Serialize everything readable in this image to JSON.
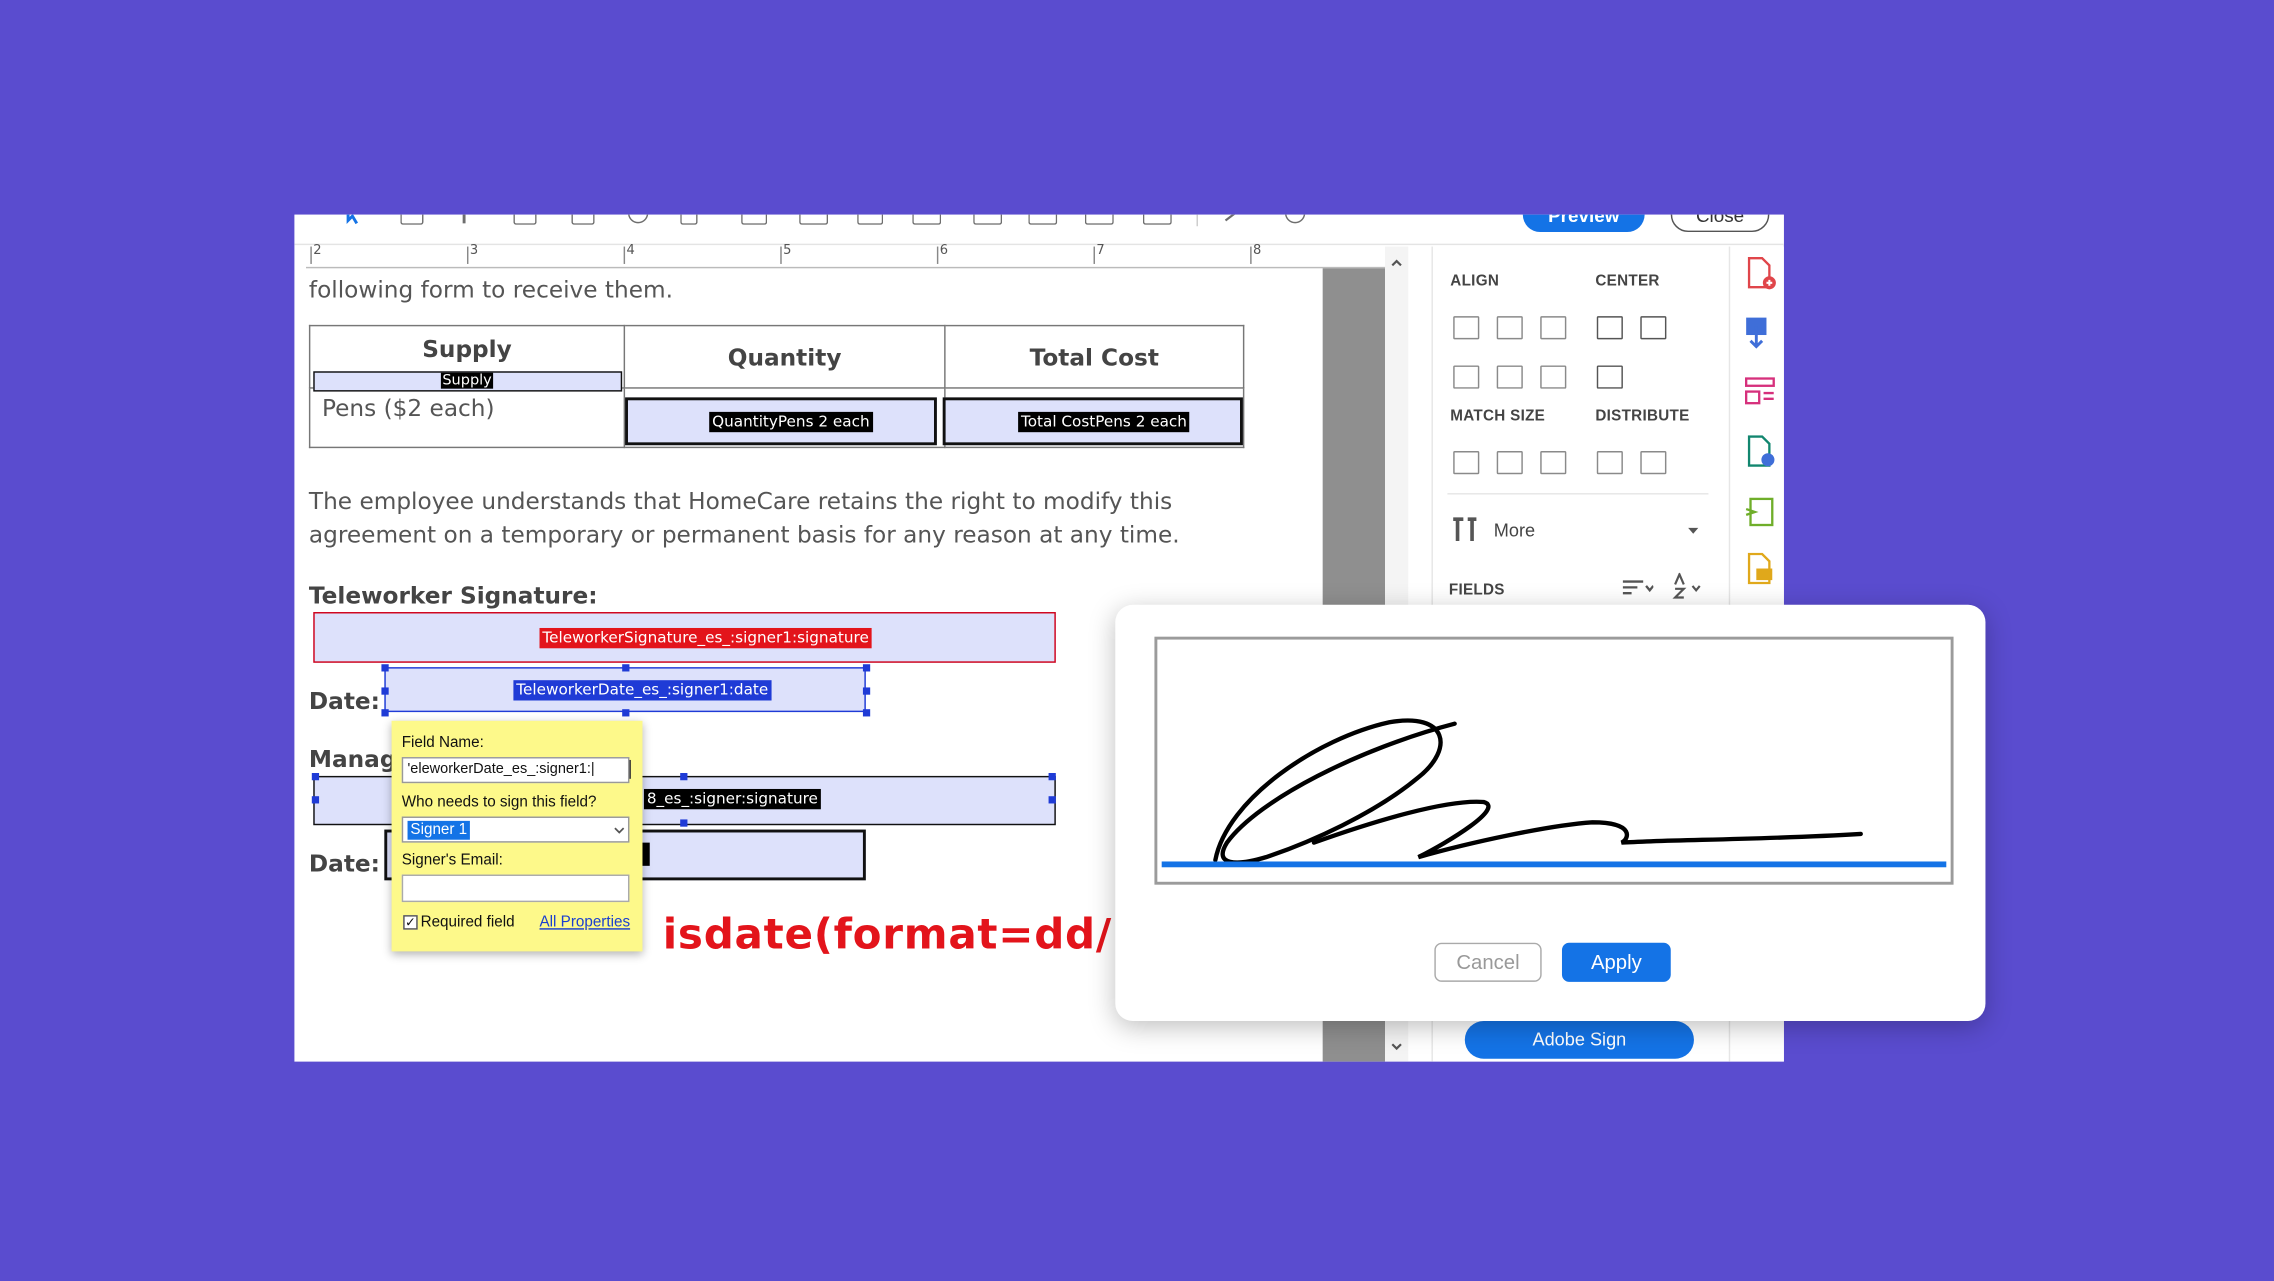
{
  "toolbar": {
    "preview_label": "Preview",
    "close_label": "Close"
  },
  "ruler": {
    "ticks": [
      "2",
      "3",
      "4",
      "5",
      "6",
      "7",
      "8"
    ]
  },
  "document": {
    "intro_text": "following form to receive them.",
    "table": {
      "headers": [
        "Supply",
        "Quantity",
        "Total Cost"
      ],
      "supply_field_label": "Supply",
      "row_label": "Pens ($2 each)",
      "quantity_field_label": "QuantityPens 2 each",
      "total_field_label": "Total CostPens 2 each"
    },
    "paragraph_line1": "The employee understands that HomeCare retains the right to modify this",
    "paragraph_line2": "agreement on a temporary or permanent basis for any reason at any time.",
    "teleworker_sig_heading": "Teleworker Signature:",
    "teleworker_sig_field": "TeleworkerSignature_es_:signer1:signature",
    "date_label_1": "Date:",
    "teleworker_date_field": "TeleworkerDate_es_:signer1:date",
    "manager_heading_partial": "Manag",
    "manager_sig_field_partial": "8_es_:signer:signature",
    "date_label_2": "Date:",
    "overlay_formula": "isdate(format=dd/mm"
  },
  "field_popup": {
    "field_name_label": "Field Name:",
    "field_name_value": "'eleworkerDate_es_:signer1:|",
    "who_label": "Who needs to sign this field?",
    "who_value": "Signer 1",
    "email_label": "Signer's Email:",
    "email_value": "",
    "required_label": "Required field",
    "required_checked": true,
    "all_properties_link": "All Properties"
  },
  "right_panel": {
    "align_label": "ALIGN",
    "center_label": "CENTER",
    "match_size_label": "MATCH SIZE",
    "distribute_label": "DISTRIBUTE",
    "more_label": "More",
    "fields_label": "FIELDS",
    "adobe_sign_label": "Adobe Sign"
  },
  "signature_dialog": {
    "cancel_label": "Cancel",
    "apply_label": "Apply"
  },
  "colors": {
    "background": "#5a4ccf",
    "accent_blue": "#1473e6",
    "field_fill": "#dde1fb",
    "signature_field_border": "#d0021b",
    "formula_red": "#e3141b",
    "popup_yellow": "#fdf98a"
  }
}
